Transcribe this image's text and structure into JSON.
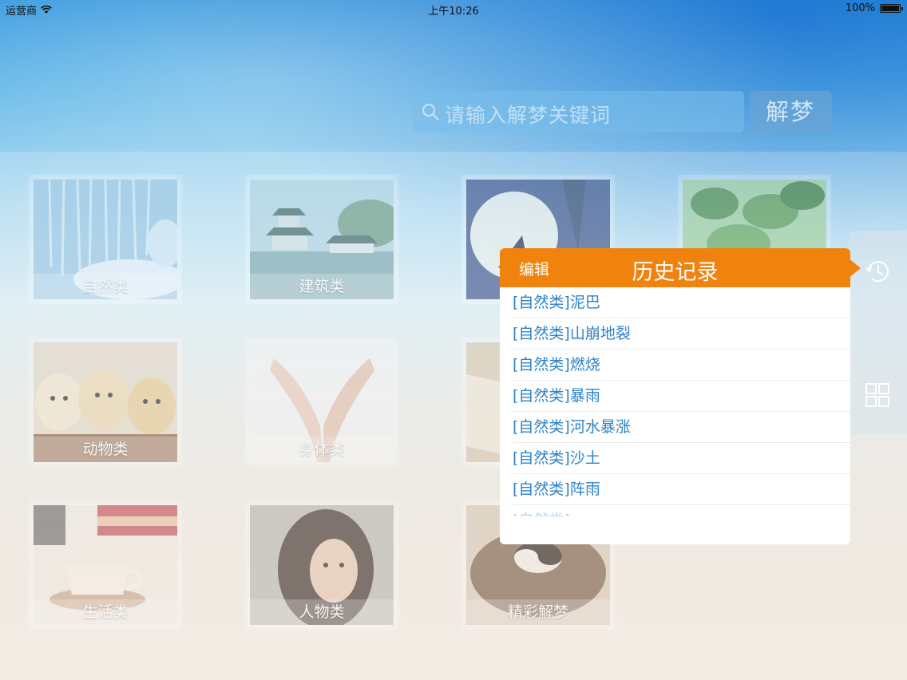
{
  "status_bar": {
    "carrier": "运营商",
    "time": "上午10:26",
    "battery": "100%"
  },
  "search": {
    "placeholder": "请输入解梦关键词",
    "button_label": "解梦"
  },
  "categories": [
    {
      "label": "自然类",
      "art": "ice-waterfall"
    },
    {
      "label": "建筑类",
      "art": "pavilion"
    },
    {
      "label": "",
      "art": "moon"
    },
    {
      "label": "",
      "art": "leaves"
    },
    {
      "label": "动物类",
      "art": "puppies"
    },
    {
      "label": "身体类",
      "art": "hands"
    },
    {
      "label": "",
      "art": "book"
    },
    {
      "label": "生活类",
      "art": "tea-cup"
    },
    {
      "label": "人物类",
      "art": "portrait"
    },
    {
      "label": "精彩解梦",
      "art": "bagua"
    }
  ],
  "history_popover": {
    "edit_label": "编辑",
    "title": "历史记录",
    "items": [
      "[自然类]泥巴",
      "[自然类]山崩地裂",
      "[自然类]燃烧",
      "[自然类]暴雨",
      "[自然类]河水暴涨",
      "[自然类]沙土",
      "[自然类]阵雨",
      "[自然类]"
    ]
  },
  "icons": {
    "history": "history-clock-icon",
    "grid": "grid-view-icon",
    "search": "search-icon"
  },
  "colors": {
    "accent_orange": "#f0830e",
    "history_text": "#2b82c9"
  }
}
